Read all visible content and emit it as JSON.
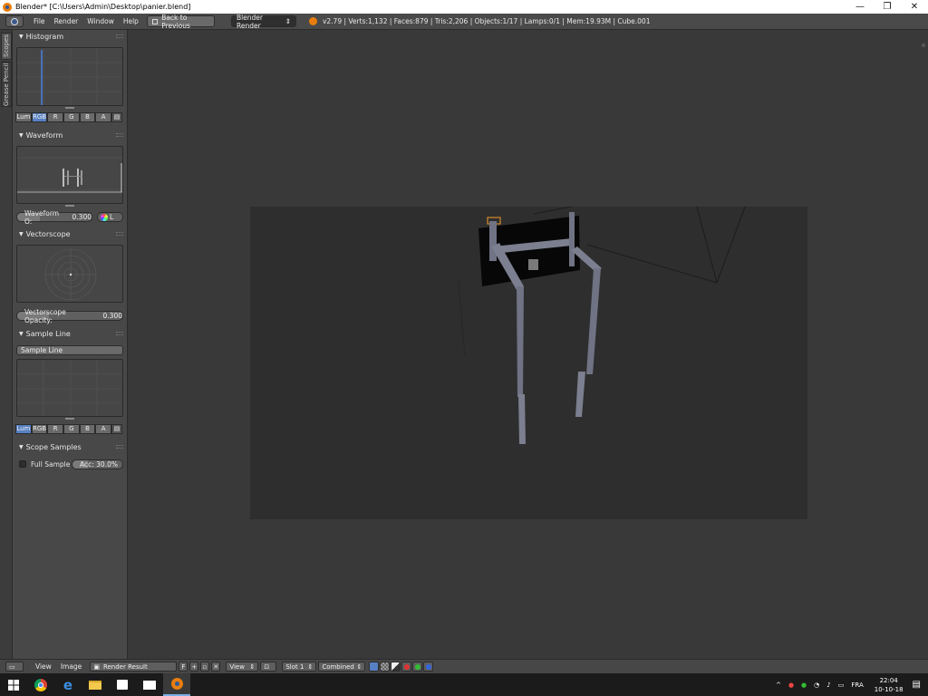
{
  "window": {
    "title": "Blender* [C:\\Users\\Admin\\Desktop\\panier.blend]",
    "minimize": "—",
    "restore": "❐",
    "close": "✕"
  },
  "info_header": {
    "menus": [
      "File",
      "Render",
      "Window",
      "Help"
    ],
    "back_button": "Back to Previous",
    "engine": "Blender Render",
    "stats": "v2.79 | Verts:1,132 | Faces:879 | Tris:2,206 | Objects:1/17 | Lamps:0/1 | Mem:19.93M | Cube.001"
  },
  "tool_tabs": [
    "Scopes",
    "Grease Pencil"
  ],
  "scopes": {
    "histogram": {
      "title": "Histogram",
      "modes": [
        "Lum",
        "RGB",
        "R",
        "G",
        "B",
        "A"
      ],
      "active_mode": "RGB"
    },
    "waveform": {
      "title": "Waveform",
      "opacity_label": "Waveform O:",
      "opacity_value": "0.300",
      "opacity_fraction": 0.3,
      "mode": "L"
    },
    "vectorscope": {
      "title": "Vectorscope",
      "opacity_label": "Vectorscope Opacity:",
      "opacity_value": "0.300",
      "opacity_fraction": 0.3
    },
    "sample_line": {
      "title": "Sample Line",
      "button": "Sample Line",
      "modes": [
        "Lum",
        "RGB",
        "R",
        "G",
        "B",
        "A"
      ],
      "active_mode": "Lum"
    },
    "scope_samples": {
      "title": "Scope Samples",
      "full_sample_label": "Full Sample",
      "full_sample_checked": false,
      "accuracy": "Acc: 30.0%",
      "accuracy_fraction": 0.3
    }
  },
  "image_header": {
    "menus": [
      "View",
      "Image"
    ],
    "image_name": "Render Result",
    "fake_user": "F",
    "view_dropdown": "View",
    "slot": "Slot 1",
    "pass": "Combined"
  },
  "taskbar": {
    "language": "FRA",
    "time": "22:04",
    "date": "10-10-18"
  },
  "colors": {
    "accent_blue": "#5680c2",
    "header_bg": "#4a4a4a",
    "panel_bg": "#484848",
    "render_bg": "#2e2e2e",
    "blender_orange": "#e87d0d"
  }
}
